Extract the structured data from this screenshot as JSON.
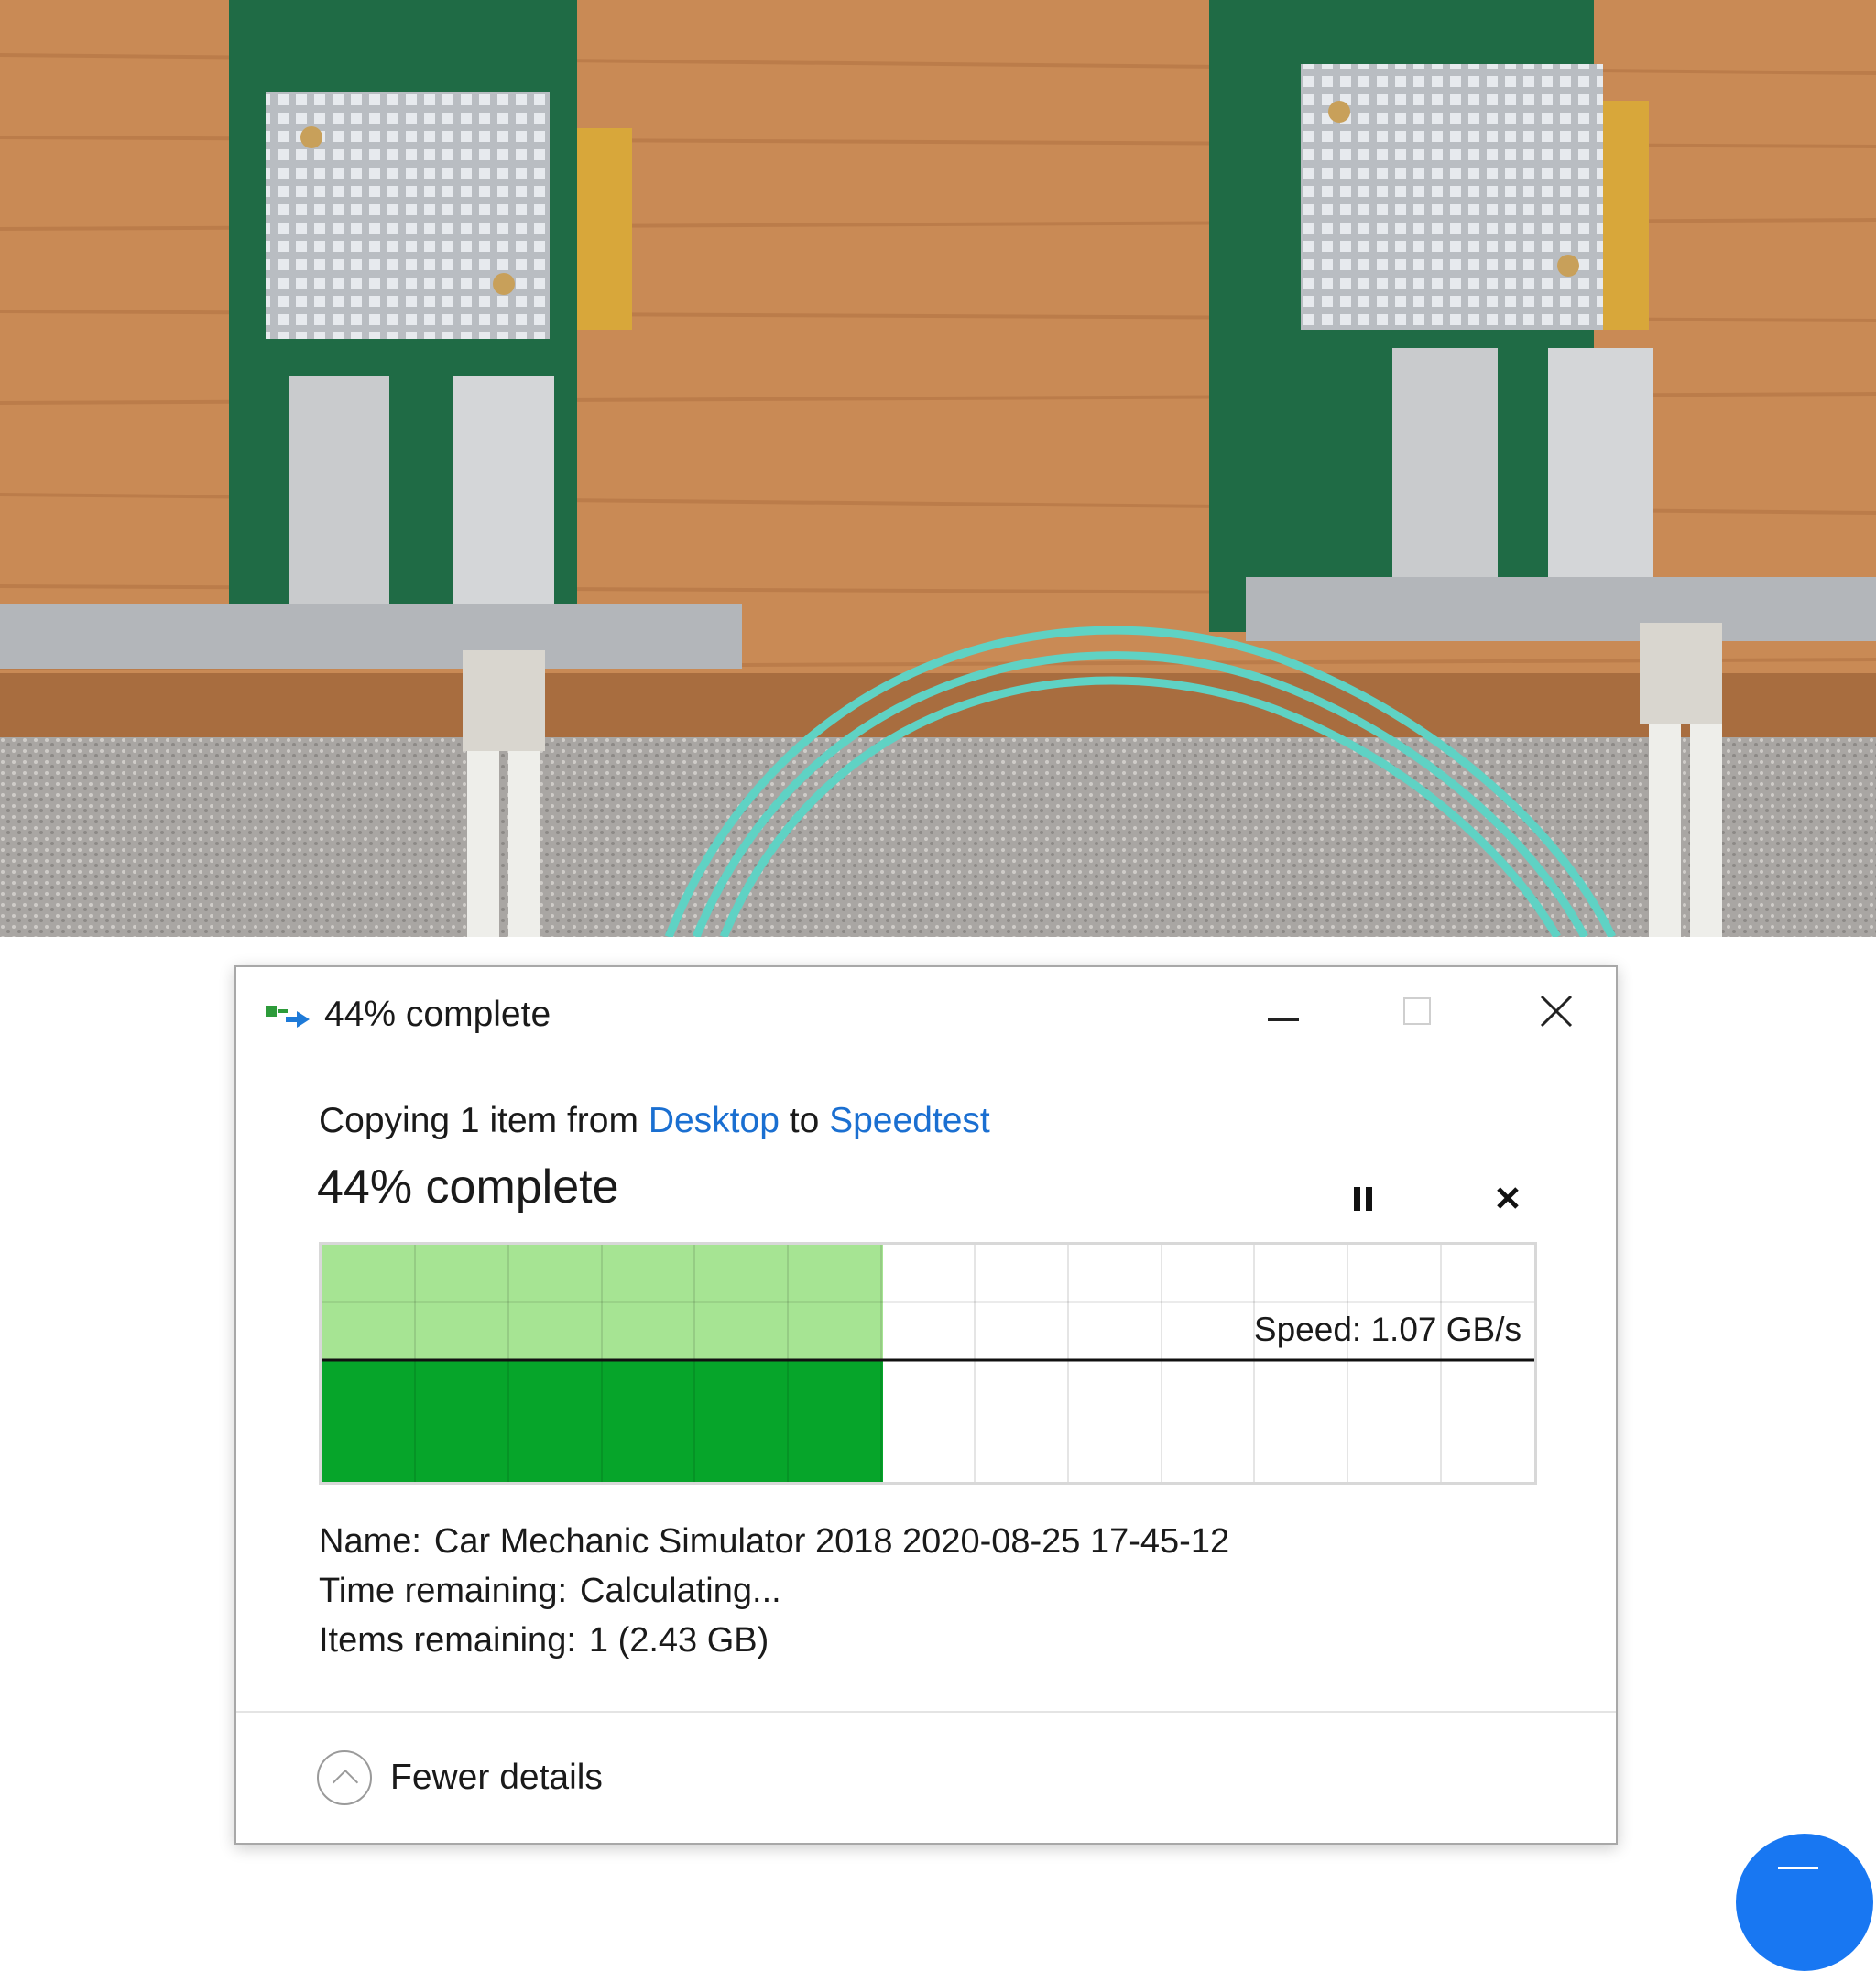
{
  "window": {
    "title": "44% complete",
    "icon": "file-copy-icon",
    "controls": [
      "minimize-icon",
      "maximize-icon",
      "close-icon"
    ]
  },
  "copy": {
    "prefix": "Copying 1 item from",
    "source": "Desktop",
    "connector": "to",
    "destination": "Speedtest"
  },
  "progress": {
    "label": "44% complete",
    "fraction": 0.44,
    "pause_icon": "pause-icon",
    "cancel_icon": "cancel-icon",
    "speed": "Speed: 1.07 GB/s",
    "fill_color": "#a6e493",
    "speed_fill_color": "#06a52a"
  },
  "details": {
    "name_label": "Name:",
    "name_value": "Car Mechanic Simulator 2018 2020-08-25 17-45-12",
    "time_label": "Time remaining:",
    "time_value": "Calculating...",
    "items_label": "Items remaining:",
    "items_value": "1 (2.43 GB)"
  },
  "footer": {
    "toggle_label": "Fewer details",
    "toggle_icon": "chevron-up-icon"
  },
  "colors": {
    "link": "#1a6fd1",
    "cable": "#5fd2c4",
    "wood": "#c98a55",
    "pcb": "#1f6b45"
  }
}
